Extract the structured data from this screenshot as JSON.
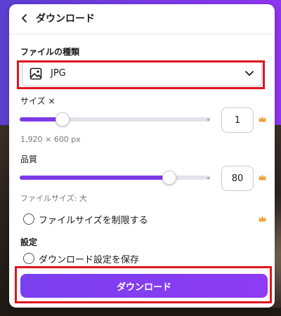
{
  "header": {
    "title": "ダウンロード"
  },
  "file_type": {
    "label": "ファイルの種類",
    "value": "JPG"
  },
  "size": {
    "label": "サイズ ×",
    "dimensions": "1,920 × 600 px",
    "value": "1",
    "slider_fraction": 0.22
  },
  "quality": {
    "label": "品質",
    "value": "80",
    "file_size_label": "ファイルサイズ: 大",
    "slider_fraction": 0.78
  },
  "limit_file_size": {
    "label": "ファイルサイズを制限する",
    "checked": false
  },
  "settings": {
    "label": "設定",
    "save_label": "ダウンロード設定を保存",
    "checked": false
  },
  "download_button": {
    "label": "ダウンロード"
  },
  "colors": {
    "accent": "#7d3ae8",
    "crown": "#f0a23a",
    "highlight": "#e0141e"
  }
}
